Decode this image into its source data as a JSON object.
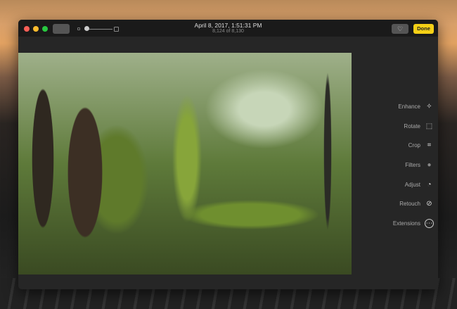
{
  "header": {
    "title": "April 8, 2017, 1:51:31 PM",
    "subtitle": "8,124 of 8,130",
    "done_label": "Done"
  },
  "tools": [
    {
      "label": "Enhance",
      "icon": "magic-wand-icon",
      "glyph": "✧"
    },
    {
      "label": "Rotate",
      "icon": "rotate-icon",
      "glyph": "⬚"
    },
    {
      "label": "Crop",
      "icon": "crop-icon",
      "glyph": "⌗"
    },
    {
      "label": "Filters",
      "icon": "filters-icon",
      "glyph": "●"
    },
    {
      "label": "Adjust",
      "icon": "adjust-icon",
      "glyph": "◔"
    },
    {
      "label": "Retouch",
      "icon": "bandage-icon",
      "glyph": "⊘"
    },
    {
      "label": "Extensions",
      "icon": "more-icon",
      "glyph": "⋯"
    }
  ],
  "colors": {
    "done": "#f5d016",
    "close": "#fc5f57",
    "minimize": "#fdbc2e",
    "zoom": "#28c840"
  }
}
